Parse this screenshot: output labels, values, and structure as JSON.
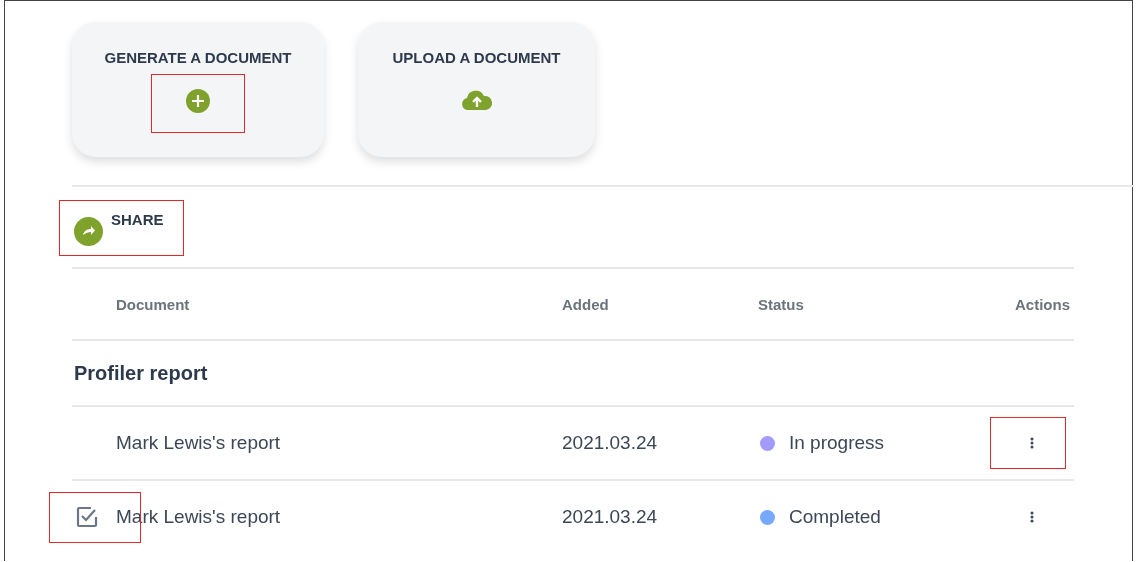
{
  "actions": [
    {
      "kind": "generate",
      "label": "GENERATE A DOCUMENT",
      "highlighted": true
    },
    {
      "kind": "upload",
      "label": "UPLOAD A DOCUMENT",
      "highlighted": false
    }
  ],
  "share": {
    "label": "SHARE",
    "highlighted": true
  },
  "table": {
    "columns": [
      "Document",
      "Added",
      "Status",
      "Actions"
    ],
    "group": "Profiler report",
    "rows": [
      {
        "document": "Mark Lewis's report",
        "added": "2021.03.24",
        "status": "In progress",
        "color": "#a39bfb",
        "checked": false,
        "checkbox_highlighted": false,
        "menu_highlighted": true
      },
      {
        "document": "Mark Lewis's report",
        "added": "2021.03.24",
        "status": "Completed",
        "color": "#76a8fc",
        "checked": true,
        "checkbox_highlighted": true,
        "menu_highlighted": false
      }
    ]
  }
}
